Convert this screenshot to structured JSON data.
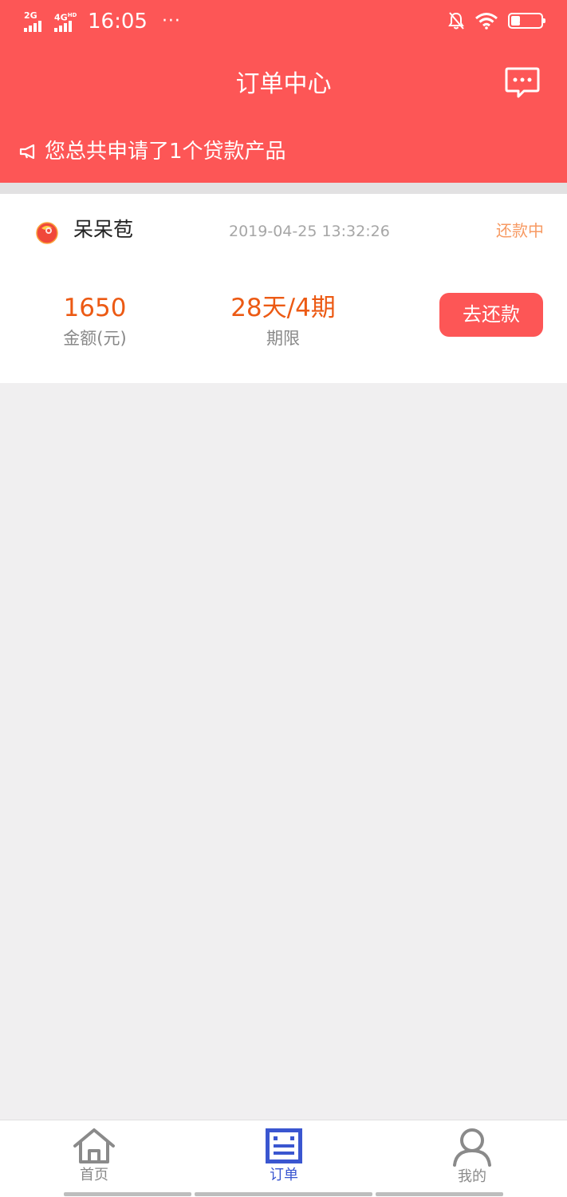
{
  "status_bar": {
    "net1": "2G",
    "net2": "4G",
    "net2_sup": "HD",
    "time": "16:05",
    "more": "···",
    "battery": "31",
    "battery_level": 0.31
  },
  "header": {
    "title": "订单中心",
    "notice": "您总共申请了1个贷款产品"
  },
  "order": {
    "product_name": "呆呆苞",
    "time": "2019-04-25 13:32:26",
    "status": "还款中",
    "amount_value": "1650",
    "amount_label": "金额(元)",
    "term_value": "28天/4期",
    "term_label": "期限",
    "repay_button": "去还款"
  },
  "tabbar": {
    "home": "首页",
    "order": "订单",
    "mine": "我的"
  },
  "colors": {
    "brand": "#fd5656",
    "accent_orange": "#ec5a14",
    "status_orange": "#f79a63",
    "tab_active": "#3a56d0",
    "tab_inactive": "#8a8a8a"
  },
  "icons": {
    "message": "chat-bubble-icon",
    "notice": "megaphone-icon",
    "home": "home-icon",
    "order": "order-list-icon",
    "mine": "user-icon",
    "logo": "product-logo-icon"
  }
}
